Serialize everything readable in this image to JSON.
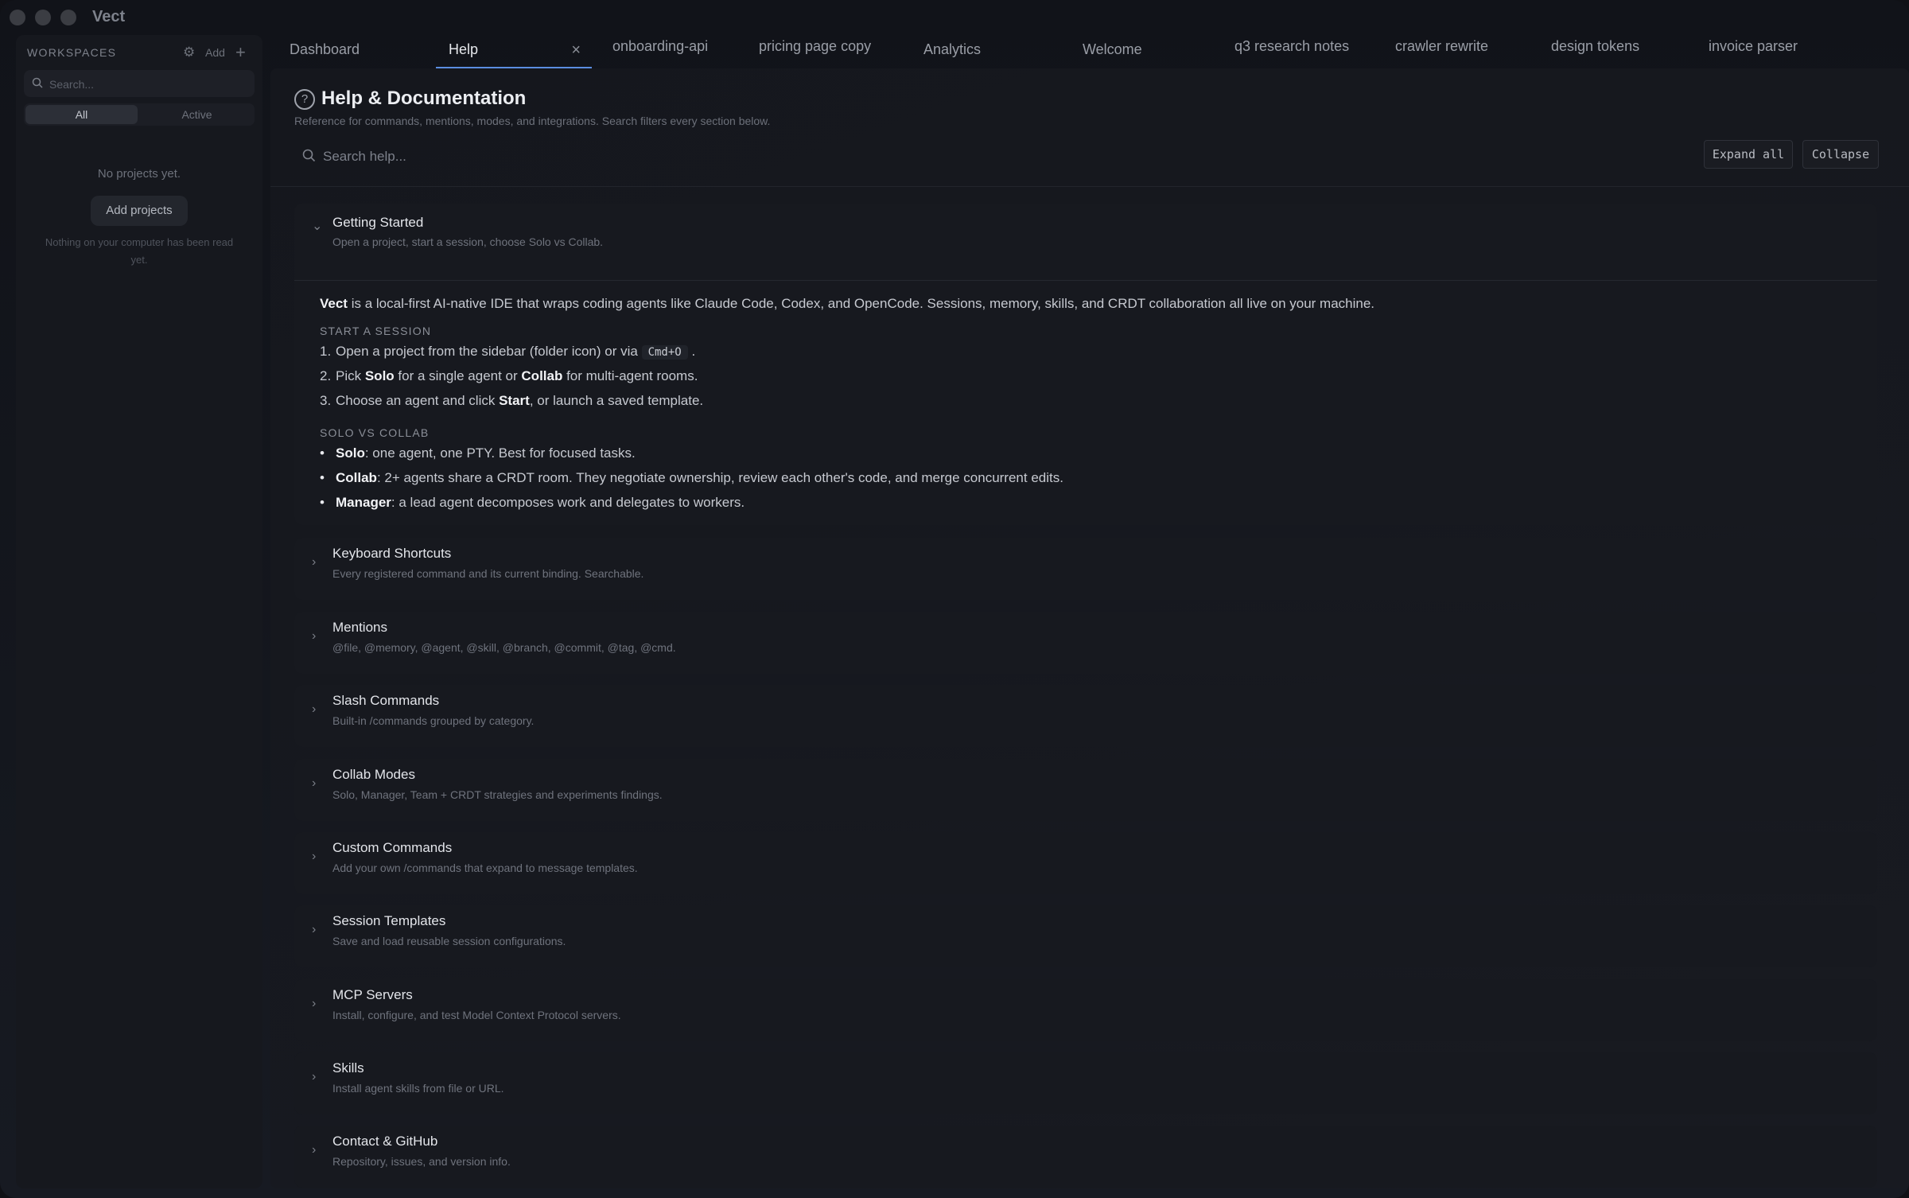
{
  "app": {
    "title": "Vect"
  },
  "sidebar": {
    "header": "WORKSPACES",
    "add_label": "Add",
    "search_placeholder": "Search...",
    "filters": [
      "All",
      "Active"
    ],
    "empty_title": "No projects yet.",
    "add_projects_label": "Add projects",
    "empty_subtitle": "Nothing on your computer has been read yet."
  },
  "tabs": [
    {
      "label": "Dashboard"
    },
    {
      "label": "Help"
    },
    {
      "label": "onboarding-api"
    },
    {
      "label": "pricing page copy"
    },
    {
      "label": "Analytics"
    },
    {
      "label": "Welcome"
    },
    {
      "label": "q3 research notes"
    },
    {
      "label": "crawler rewrite"
    },
    {
      "label": "design tokens"
    },
    {
      "label": "invoice parser"
    }
  ],
  "main": {
    "title": "Help & Documentation",
    "subtitle": "Reference for commands, mentions, modes, and integrations. Search filters every section below.",
    "search_placeholder": "Search help...",
    "expand_all": "Expand all",
    "collapse": "Collapse",
    "getting_started": {
      "title": "Getting Started",
      "desc": "Open a project, start a session, choose Solo vs Collab.",
      "intro_name": "Vect",
      "intro_rest": " is a local-first AI-native IDE that wraps coding agents like Claude Code, Codex, and OpenCode. Sessions, memory, skills, and CRDT collaboration all live on your machine.",
      "start_heading": "START A SESSION",
      "step1_num": "1.",
      "step1_a": "Open a project from the sidebar (folder icon) or via ",
      "step1_kbd": "Cmd+O",
      "step1_b": " .",
      "step2_num": "2.",
      "step2_a": "Pick ",
      "step2_b1": "Solo",
      "step2_c": " for a single agent or ",
      "step2_b2": "Collab",
      "step2_d": " for multi-agent rooms.",
      "step3_num": "3.",
      "step3_a": "Choose an agent and click ",
      "step3_b": "Start",
      "step3_c": ", or launch a saved template.",
      "modes_heading": "SOLO VS COLLAB",
      "bullet": "•",
      "solo_b": "Solo",
      "solo_rest": ": one agent, one PTY. Best for focused tasks.",
      "collab_b": "Collab",
      "collab_rest": ": 2+ agents share a CRDT room. They negotiate ownership, review each other's code, and merge concurrent edits.",
      "manager_b": "Manager",
      "manager_rest": ": a lead agent decomposes work and delegates to workers."
    },
    "sections": [
      {
        "title": "Keyboard Shortcuts",
        "desc": "Every registered command and its current binding. Searchable."
      },
      {
        "title": "Mentions",
        "desc": "@file, @memory, @agent, @skill, @branch, @commit, @tag, @cmd."
      },
      {
        "title": "Slash Commands",
        "desc": "Built-in /commands grouped by category."
      },
      {
        "title": "Collab Modes",
        "desc": "Solo, Manager, Team + CRDT strategies and experiments findings."
      },
      {
        "title": "Custom Commands",
        "desc": "Add your own /commands that expand to message templates."
      },
      {
        "title": "Session Templates",
        "desc": "Save and load reusable session configurations."
      },
      {
        "title": "MCP Servers",
        "desc": "Install, configure, and test Model Context Protocol servers."
      },
      {
        "title": "Skills",
        "desc": "Install agent skills from file or URL."
      },
      {
        "title": "Contact & GitHub",
        "desc": "Repository, issues, and version info."
      }
    ]
  },
  "icons": {
    "chevron_down": "⌄",
    "chevron_right": "›",
    "close": "×",
    "gear": "⚙",
    "plus": "+",
    "help": "?"
  },
  "colors": {
    "accent": "#5b8de0",
    "background": "#14161c"
  }
}
